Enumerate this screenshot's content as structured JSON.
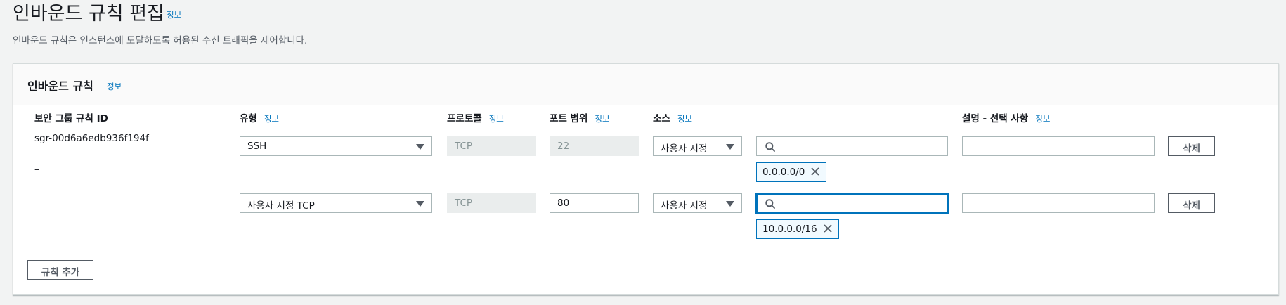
{
  "page": {
    "title": "인바운드 규칙 편집",
    "info": "정보",
    "description": "인바운드 규칙은 인스턴스에 도달하도록 허용된 수신 트래픽을 제어합니다."
  },
  "panel": {
    "title": "인바운드 규칙",
    "info": "정보",
    "columns": {
      "rule_id": "보안 그룹 규칙 ID",
      "type": "유형",
      "protocol": "프로토콜",
      "port_range": "포트 범위",
      "source": "소스",
      "description": "설명 - 선택 사항",
      "info": "정보"
    },
    "rows": [
      {
        "rule_id": "sgr-00d6a6edb936f194f",
        "type": "SSH",
        "protocol": "TCP",
        "port_range": "22",
        "source_type": "사용자 지정",
        "source_search": "",
        "source_token": "0.0.0.0/0",
        "description": "",
        "delete_label": "삭제"
      },
      {
        "rule_id": "–",
        "type": "사용자 지정 TCP",
        "protocol": "TCP",
        "port_range": "80",
        "source_type": "사용자 지정",
        "source_search": "",
        "source_token": "10.0.0.0/16",
        "description": "",
        "delete_label": "삭제"
      }
    ],
    "add_rule_label": "규칙 추가"
  },
  "icons": {
    "search": "search-icon",
    "remove": "close-icon",
    "dropdown": "caret-down-icon"
  },
  "colors": {
    "link": "#0073bb",
    "focus": "#0073bb",
    "token_bg": "#f1faff"
  }
}
